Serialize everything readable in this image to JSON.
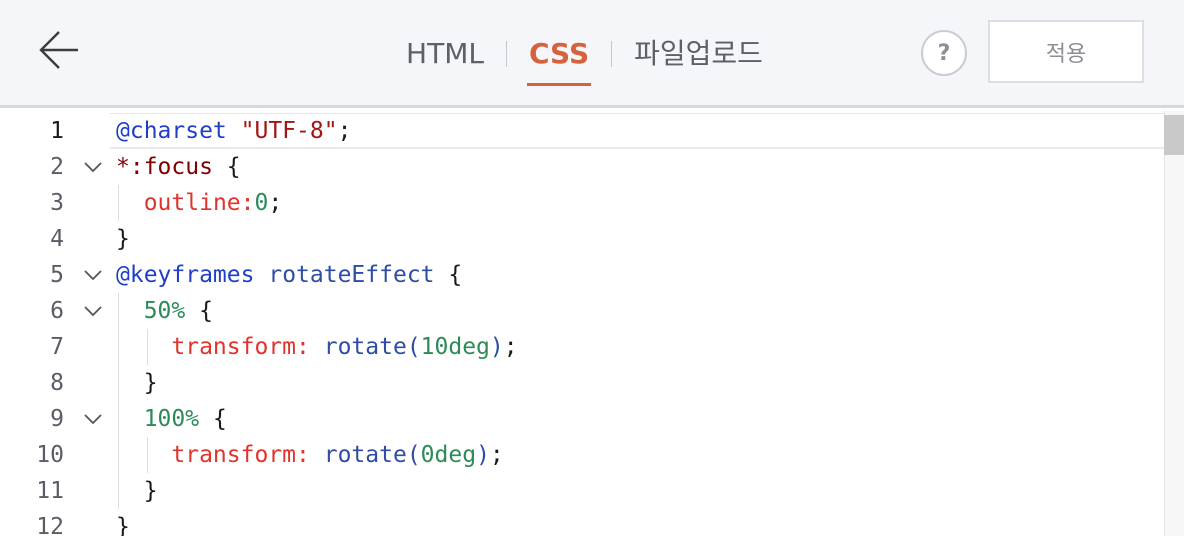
{
  "tabs": [
    {
      "label": "HTML",
      "active": false
    },
    {
      "label": "CSS",
      "active": true
    },
    {
      "label": "파일업로드",
      "active": false
    }
  ],
  "help_label": "?",
  "apply_label": "적용",
  "icons": {
    "back": "arrow-left-icon",
    "help": "question-mark-icon",
    "fold": "chevron-down-icon"
  },
  "colors": {
    "accent": "#d6613f",
    "at_rule": "#1f3fc7",
    "string": "#a31515",
    "selector": "#800000",
    "property": "#e0332b",
    "number": "#2e8b57",
    "function": "#2d4ea3"
  },
  "editor": {
    "active_line": 1,
    "lines": [
      {
        "num": "1",
        "fold": false,
        "tokens": [
          {
            "t": "@charset",
            "c": "at"
          },
          {
            "t": " ",
            "c": "p"
          },
          {
            "t": "\"UTF-8\"",
            "c": "str"
          },
          {
            "t": ";",
            "c": "p"
          }
        ]
      },
      {
        "num": "2",
        "fold": true,
        "tokens": [
          {
            "t": "*:focus",
            "c": "sel"
          },
          {
            "t": " {",
            "c": "p"
          }
        ]
      },
      {
        "num": "3",
        "fold": false,
        "tokens": [
          {
            "t": "  ",
            "c": "p"
          },
          {
            "t": "outline:",
            "c": "prop"
          },
          {
            "t": "0",
            "c": "num"
          },
          {
            "t": ";",
            "c": "p"
          }
        ]
      },
      {
        "num": "4",
        "fold": false,
        "tokens": [
          {
            "t": "}",
            "c": "p"
          }
        ]
      },
      {
        "num": "5",
        "fold": true,
        "tokens": [
          {
            "t": "@keyframes",
            "c": "at"
          },
          {
            "t": " ",
            "c": "p"
          },
          {
            "t": "rotateEffect",
            "c": "name"
          },
          {
            "t": " {",
            "c": "p"
          }
        ]
      },
      {
        "num": "6",
        "fold": true,
        "tokens": [
          {
            "t": "  ",
            "c": "p"
          },
          {
            "t": "50%",
            "c": "num"
          },
          {
            "t": " {",
            "c": "p"
          }
        ]
      },
      {
        "num": "7",
        "fold": false,
        "tokens": [
          {
            "t": "    ",
            "c": "p"
          },
          {
            "t": "transform:",
            "c": "prop"
          },
          {
            "t": " ",
            "c": "p"
          },
          {
            "t": "rotate(",
            "c": "fn"
          },
          {
            "t": "10deg",
            "c": "num"
          },
          {
            "t": ")",
            "c": "fn"
          },
          {
            "t": ";",
            "c": "p"
          }
        ]
      },
      {
        "num": "8",
        "fold": false,
        "tokens": [
          {
            "t": "  }",
            "c": "p"
          }
        ]
      },
      {
        "num": "9",
        "fold": true,
        "tokens": [
          {
            "t": "  ",
            "c": "p"
          },
          {
            "t": "100%",
            "c": "num"
          },
          {
            "t": " {",
            "c": "p"
          }
        ]
      },
      {
        "num": "10",
        "fold": false,
        "tokens": [
          {
            "t": "    ",
            "c": "p"
          },
          {
            "t": "transform:",
            "c": "prop"
          },
          {
            "t": " ",
            "c": "p"
          },
          {
            "t": "rotate(",
            "c": "fn"
          },
          {
            "t": "0deg",
            "c": "num"
          },
          {
            "t": ")",
            "c": "fn"
          },
          {
            "t": ";",
            "c": "p"
          }
        ]
      },
      {
        "num": "11",
        "fold": false,
        "tokens": [
          {
            "t": "  }",
            "c": "p"
          }
        ]
      },
      {
        "num": "12",
        "fold": false,
        "tokens": [
          {
            "t": "}",
            "c": "p"
          }
        ]
      }
    ]
  }
}
